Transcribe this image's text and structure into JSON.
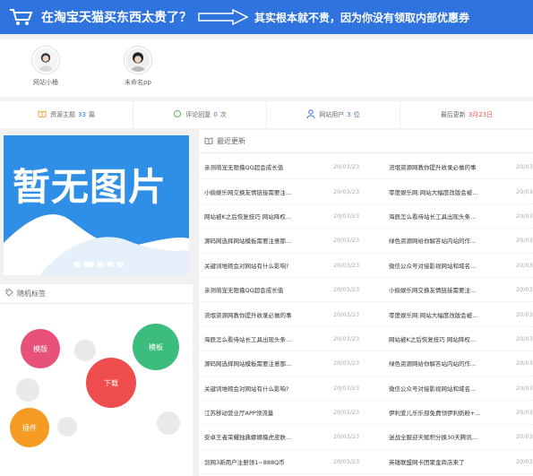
{
  "banner": {
    "text_left": "在淘宝天猫买东西太贵了？",
    "text_right": "其实根本就不贵，因为你没有领取内部优惠券"
  },
  "users": [
    {
      "name": "网站小桶"
    },
    {
      "name": "未命名pp"
    }
  ],
  "stats": {
    "resources_label": "资源主题",
    "resources_value": "33",
    "resources_unit": "篇",
    "comments_label": "评论回复",
    "comments_value": "0",
    "comments_unit": "次",
    "users_label": "网站用户",
    "users_value": "3",
    "users_unit": "位",
    "updated_label": "最后更新",
    "updated_value": "3月23日"
  },
  "slider": {
    "image_text": "暂无图片",
    "slide_count": 5,
    "active_slide": 2
  },
  "tags": {
    "title": "随机标签",
    "items": [
      {
        "label": "模版",
        "color": "#e8527a"
      },
      {
        "label": "模板",
        "color": "#3dbd7d"
      },
      {
        "label": "下载",
        "color": "#ef4d4d"
      },
      {
        "label": "插件",
        "color": "#f59a23"
      }
    ]
  },
  "recent": {
    "title": "最近更新",
    "rows": [
      {
        "left": "亲测萌宠无限撸QQ超会成长值",
        "left_date": "20/03/23",
        "right": "流氓资源网教你提升收录必做的事",
        "right_date": "20/03"
      },
      {
        "left": "小偷娱乐网交换友情链接需要注...",
        "left_date": "20/03/23",
        "right": "零度娱乐网:网站大幅度改版会被...",
        "right_date": "20/03"
      },
      {
        "left": "网站被K之后恢复技巧 网站降权...",
        "left_date": "20/03/23",
        "right": "海辰怎么看待站长工具出现头条...",
        "right_date": "20/03"
      },
      {
        "left": "源码网选择网站模板需要注意那...",
        "left_date": "20/03/23",
        "right": "绿色资源网给你解答站内站的作...",
        "right_date": "20/03"
      },
      {
        "left": "关键词堆砌会对网站有什么影响?",
        "left_date": "20/03/23",
        "right": "微信公众号对接影视网站和域名...",
        "right_date": "20/03"
      },
      {
        "left": "亲测萌宠无限撸QQ超会成长值",
        "left_date": "20/03/23",
        "right": "小偷娱乐网交换友情链接需要注...",
        "right_date": "20/03"
      },
      {
        "left": "流氓资源网教你提升收录必做的事",
        "left_date": "20/03/23",
        "right": "零度娱乐网:网站大幅度改版会被...",
        "right_date": "20/03"
      },
      {
        "left": "海辰怎么看待站长工具出现头条...",
        "left_date": "20/03/23",
        "right": "网站被K之后恢复技巧 网站降权...",
        "right_date": "20/03"
      },
      {
        "left": "源码网选择网站模板需要注意那...",
        "left_date": "20/03/23",
        "right": "绿色资源网给你解答站内站的作...",
        "right_date": "20/03"
      },
      {
        "left": "关键词堆砌会对网站有什么影响?",
        "left_date": "20/03/23",
        "right": "微信公众号对接影视网站和域名...",
        "right_date": "20/03"
      },
      {
        "left": "江苏移动营业厅APP领流量",
        "left_date": "20/03/23",
        "right": "伊利爱儿乐乐部免费领伊利奶粉+...",
        "right_date": "20/03"
      },
      {
        "left": "安卓王者荣耀独典娜娜撸虎皮肤...",
        "left_date": "20/03/23",
        "right": "迷战全服迎天赋积分换30天腾讯...",
        "right_date": "20/03"
      },
      {
        "left": "剑网3新用户注册领1~888Q币",
        "left_date": "20/03/23",
        "right": "英雄联盟网卡团聚金商店来了",
        "right_date": "20/03"
      }
    ]
  }
}
